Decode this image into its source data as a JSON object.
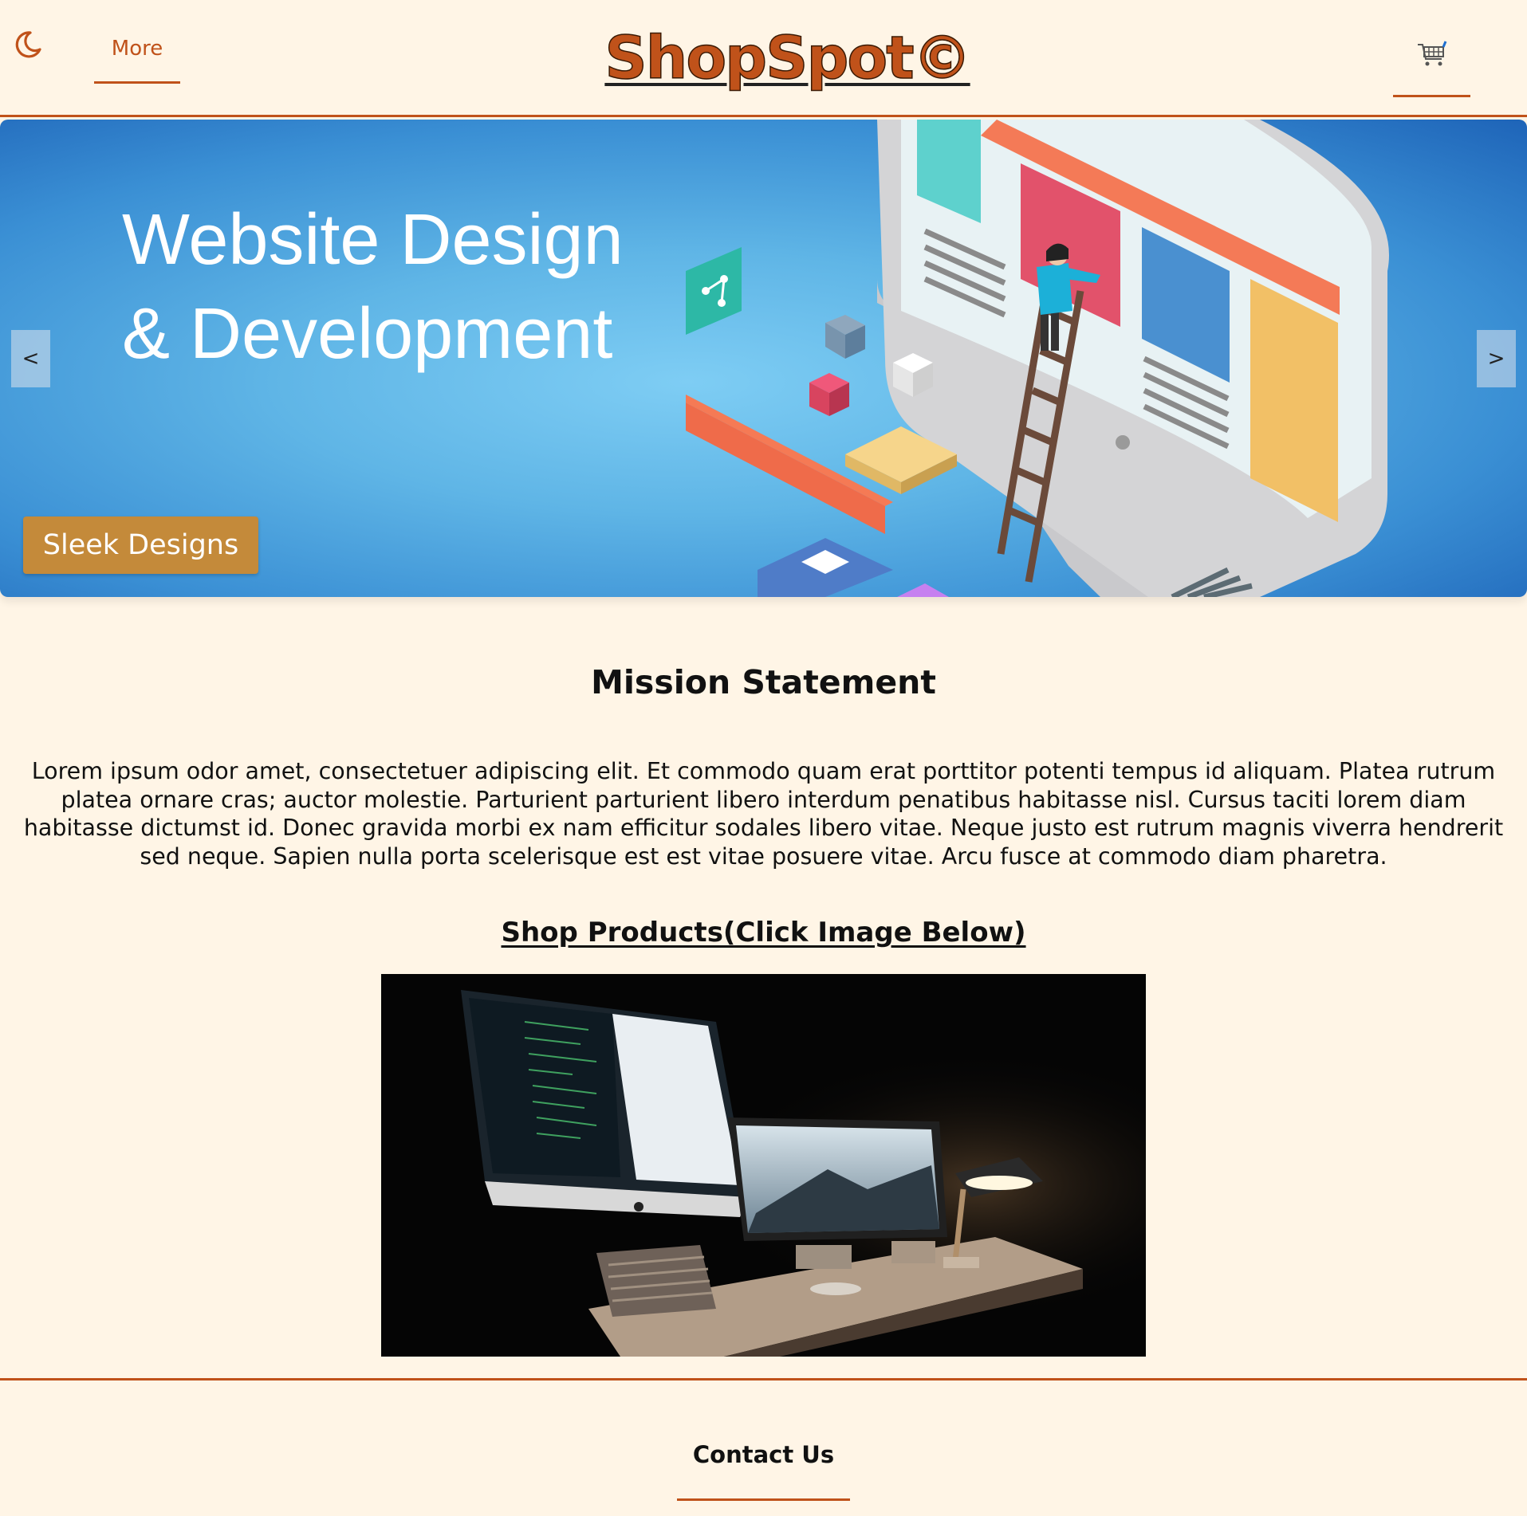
{
  "header": {
    "theme_toggle_icon": "moon-icon",
    "more_label": "More",
    "logo_text": "ShopSpot©",
    "cart_icon": "shopping-cart-icon",
    "accent_color": "#c0521a"
  },
  "hero": {
    "title_line1": "Website Design",
    "title_line2": "& Development",
    "prev_label": "<",
    "next_label": ">",
    "caption": "Sleek Designs"
  },
  "mission": {
    "heading": "Mission Statement",
    "body": "Lorem ipsum odor amet, consectetuer adipiscing elit. Et commodo quam erat porttitor potenti tempus id aliquam. Platea rutrum platea ornare cras; auctor molestie. Parturient parturient libero interdum penatibus habitasse nisl. Cursus taciti lorem diam habitasse dictumst id. Donec gravida morbi ex nam efficitur sodales libero vitae. Neque justo est rutrum magnis viverra hendrerit sed neque. Sapien nulla porta scelerisque est est vitae posuere vitae. Arcu fusce at commodo diam pharetra."
  },
  "shop": {
    "heading": "Shop Products(Click Image Below)"
  },
  "footer": {
    "contact_label": "Contact Us"
  }
}
